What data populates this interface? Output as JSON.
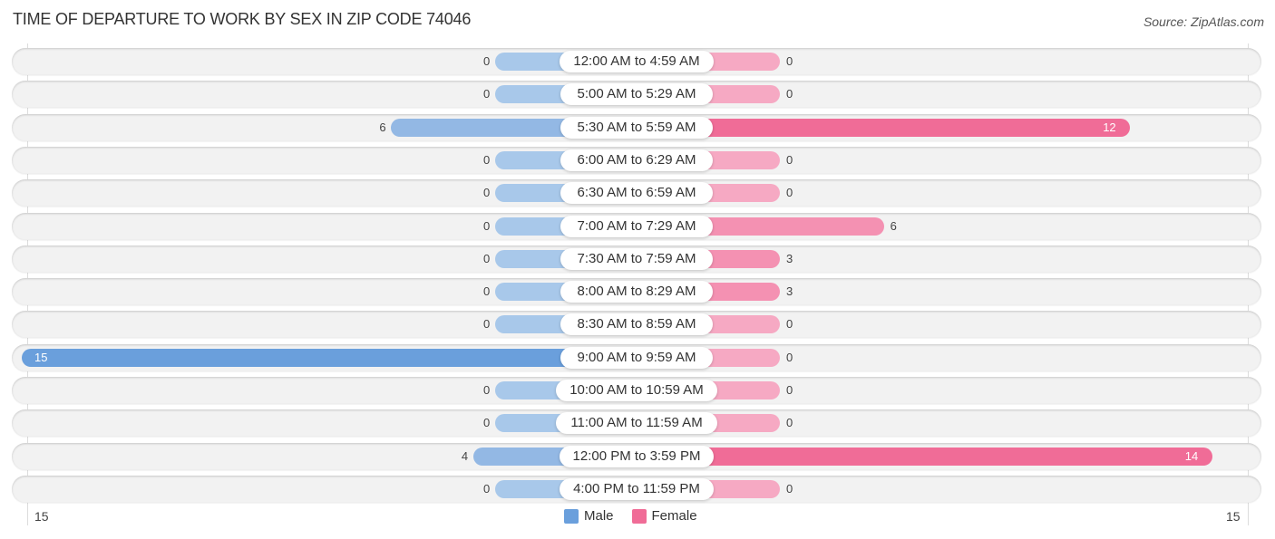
{
  "header": {
    "title": "TIME OF DEPARTURE TO WORK BY SEX IN ZIP CODE 74046",
    "source": "Source: ZipAtlas.com"
  },
  "colors": {
    "male": "#6a9fdc",
    "female": "#f06c97"
  },
  "chart_data": {
    "type": "bar",
    "orientation": "horizontal-diverging",
    "title": "TIME OF DEPARTURE TO WORK BY SEX IN ZIP CODE 74046",
    "categories": [
      "12:00 AM to 4:59 AM",
      "5:00 AM to 5:29 AM",
      "5:30 AM to 5:59 AM",
      "6:00 AM to 6:29 AM",
      "6:30 AM to 6:59 AM",
      "7:00 AM to 7:29 AM",
      "7:30 AM to 7:59 AM",
      "8:00 AM to 8:29 AM",
      "8:30 AM to 8:59 AM",
      "9:00 AM to 9:59 AM",
      "10:00 AM to 10:59 AM",
      "11:00 AM to 11:59 AM",
      "12:00 PM to 3:59 PM",
      "4:00 PM to 11:59 PM"
    ],
    "series": [
      {
        "name": "Male",
        "values": [
          0,
          0,
          6,
          0,
          0,
          0,
          0,
          0,
          0,
          15,
          0,
          0,
          4,
          0
        ]
      },
      {
        "name": "Female",
        "values": [
          0,
          0,
          12,
          0,
          0,
          6,
          3,
          3,
          0,
          0,
          0,
          0,
          14,
          0
        ]
      }
    ],
    "axis": {
      "min_label": "15",
      "max_label": "15",
      "range": [
        0,
        15
      ]
    },
    "legend": {
      "position": "bottom-center",
      "entries": [
        "Male",
        "Female"
      ]
    },
    "xlabel": "",
    "ylabel": ""
  }
}
